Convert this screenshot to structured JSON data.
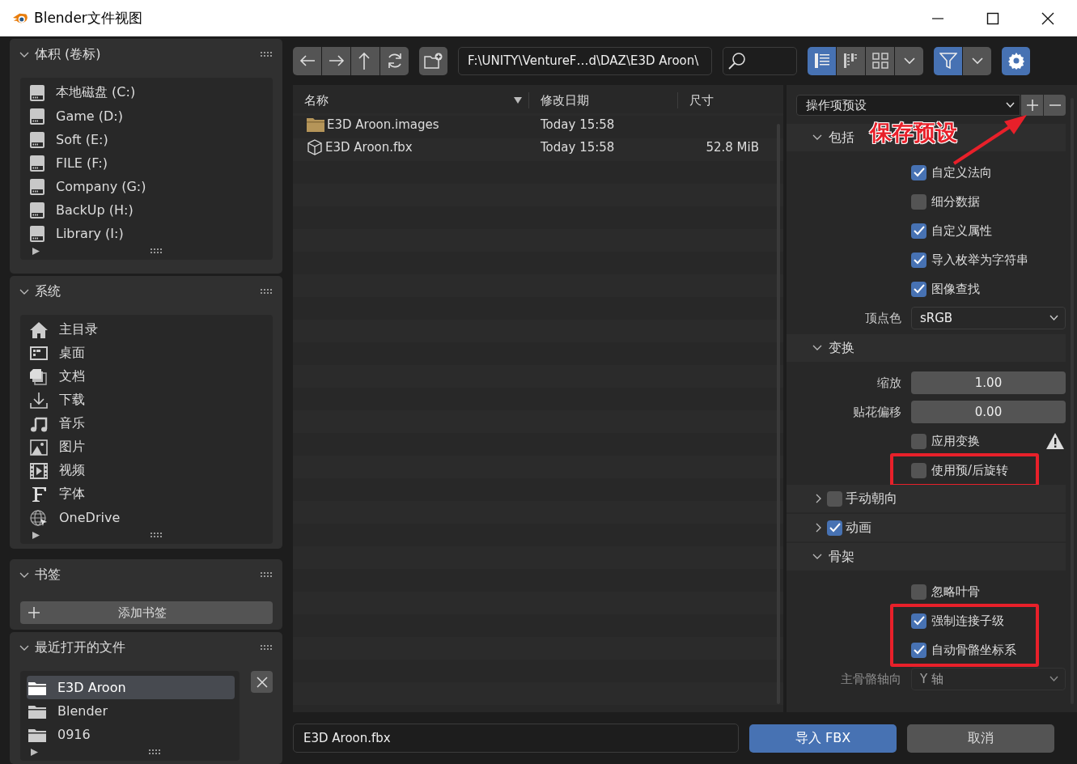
{
  "window": {
    "title": "Blender文件视图"
  },
  "sidebar": {
    "sections": [
      {
        "kind": "drives",
        "title": "体积 (卷标)",
        "expanded": true,
        "items": [
          {
            "label": "本地磁盘 (C:)"
          },
          {
            "label": "Game (D:)"
          },
          {
            "label": "Soft (E:)"
          },
          {
            "label": "FILE (F:)"
          },
          {
            "label": "Company (G:)"
          },
          {
            "label": "BackUp (H:)"
          },
          {
            "label": "Library (I:)"
          }
        ]
      },
      {
        "kind": "system",
        "title": "系统",
        "expanded": true,
        "items": [
          {
            "label": "主目录"
          },
          {
            "label": "桌面"
          },
          {
            "label": "文档"
          },
          {
            "label": "下载"
          },
          {
            "label": "音乐"
          },
          {
            "label": "图片"
          },
          {
            "label": "视频"
          },
          {
            "label": "字体"
          },
          {
            "label": "OneDrive"
          }
        ]
      },
      {
        "kind": "bookmarks",
        "title": "书签",
        "expanded": true,
        "button": "添加书签"
      },
      {
        "kind": "recent",
        "title": "最近打开的文件",
        "expanded": true,
        "items": [
          {
            "label": "E3D Aroon",
            "selected": true
          },
          {
            "label": "Blender",
            "selected": false
          },
          {
            "label": "0916",
            "selected": false
          }
        ]
      }
    ]
  },
  "toolbar": {
    "path": "F:\\UNITY\\VentureF…d\\DAZ\\E3D Aroon\\",
    "view_modes": [
      {
        "selected": true
      },
      {
        "selected": false
      },
      {
        "selected": false
      }
    ],
    "filter_on": true
  },
  "file_list": {
    "columns": [
      "名称",
      "修改日期",
      "尺寸"
    ],
    "rows": [
      {
        "kind": "folder",
        "name": "E3D Aroon.images",
        "date": "Today 15:58"
      },
      {
        "kind": "file",
        "name": "E3D Aroon.fbx",
        "date": "Today 15:58",
        "size": "52.8 MiB"
      }
    ]
  },
  "options_panel": {
    "preset": "操作项预设",
    "options": [
      {
        "kind": "header",
        "label": "包括",
        "expanded": true
      },
      {
        "kind": "checkbox",
        "label": "自定义法向",
        "checked": true
      },
      {
        "kind": "checkbox",
        "label": "细分数据",
        "checked": false
      },
      {
        "kind": "checkbox",
        "label": "自定义属性",
        "checked": true
      },
      {
        "kind": "checkbox",
        "label": "导入枚举为字符串",
        "checked": true
      },
      {
        "kind": "checkbox",
        "label": "图像查找",
        "checked": true
      },
      {
        "kind": "select",
        "label": "顶点色",
        "value": "sRGB",
        "disabled": false
      },
      {
        "kind": "header",
        "label": "变换",
        "expanded": true
      },
      {
        "kind": "number",
        "label": "缩放",
        "value": "1.00"
      },
      {
        "kind": "number",
        "label": "贴花偏移",
        "value": "0.00"
      },
      {
        "kind": "checkbox",
        "label": "应用变换",
        "checked": false,
        "warning": true
      },
      {
        "kind": "checkbox",
        "label": "使用预/后旋转",
        "checked": false,
        "highlighted": true
      },
      {
        "kind": "check_header",
        "label": "手动朝向",
        "expanded": false,
        "checked": false
      },
      {
        "kind": "check_header",
        "label": "动画",
        "expanded": false,
        "checked": true
      },
      {
        "kind": "header",
        "label": "骨架",
        "expanded": true
      },
      {
        "kind": "checkbox",
        "label": "忽略叶骨",
        "checked": false
      },
      {
        "kind": "checkbox",
        "label": "强制连接子级",
        "checked": true,
        "highlighted": true
      },
      {
        "kind": "checkbox",
        "label": "自动骨骼坐标系",
        "checked": true,
        "highlighted": true
      },
      {
        "kind": "select",
        "label": "主骨骼轴向",
        "value": "Y 轴",
        "disabled": true
      }
    ]
  },
  "annotation": {
    "text": "保存预设"
  },
  "footer": {
    "filename": "E3D Aroon.fbx",
    "buttons": [
      {
        "kind": "primary",
        "label": "导入 FBX"
      },
      {
        "kind": "secondary",
        "label": "取消"
      }
    ]
  }
}
